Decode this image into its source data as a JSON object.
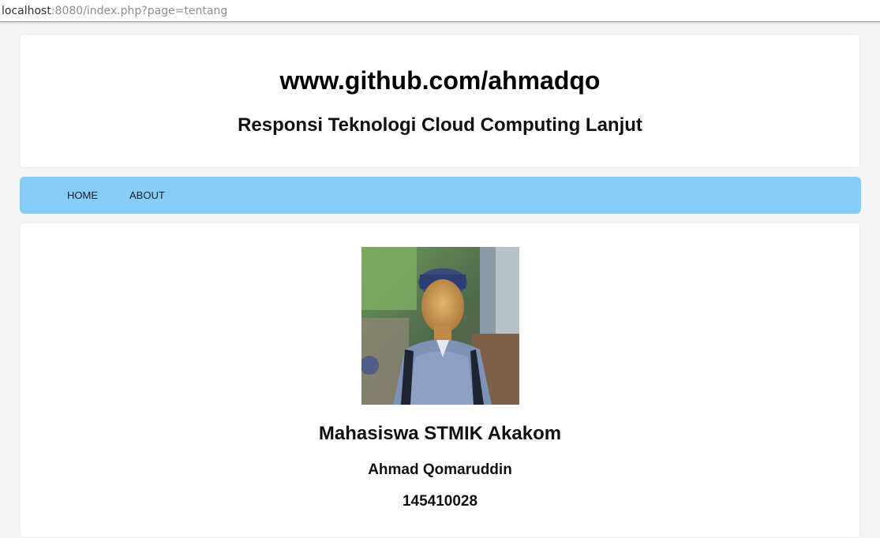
{
  "browser": {
    "url_host": "localhost",
    "url_rest": ":8080/index.php?page=tentang"
  },
  "header": {
    "title": "www.github.com/ahmadqo",
    "subtitle": "Responsi Teknologi Cloud Computing Lanjut"
  },
  "nav": {
    "items": [
      {
        "label": "HOME"
      },
      {
        "label": "ABOUT"
      }
    ],
    "background": "#87cdf9"
  },
  "profile": {
    "heading": "Mahasiswa STMIK Akakom",
    "name": "Ahmad Qomaruddin",
    "id_number": "145410028",
    "photo_icon": "student-portrait-photo"
  }
}
